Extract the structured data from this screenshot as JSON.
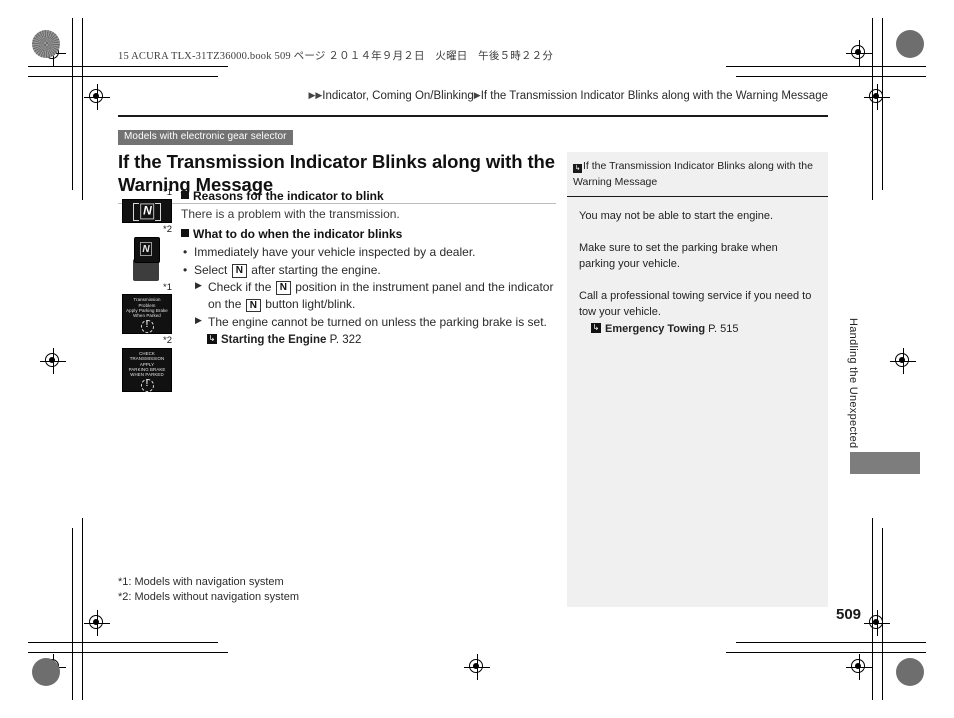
{
  "print_header": "15 ACURA TLX-31TZ36000.book    509 ページ    ２０１４年９月２日　火曜日　午後５時２２分",
  "breadcrumb": {
    "arrow": "▶",
    "section": "Indicator, Coming On/Blinking",
    "topic": "If the Transmission Indicator Blinks along with the Warning Message"
  },
  "left": {
    "model_badge": "Models with electronic gear selector",
    "title": "If the Transmission Indicator Blinks along with the Warning Message",
    "sections": [
      {
        "heading": "Reasons for the indicator to blink",
        "text": "There is a problem with the transmission."
      },
      {
        "heading": "What to do when the indicator blinks"
      }
    ],
    "bullet_1": "Immediately have your vehicle inspected by a dealer.",
    "bullet_2_pre": "Select",
    "bullet_2_key": "N",
    "bullet_2_post": "after starting the engine.",
    "sub_1_a": "Check if the",
    "sub_1_key1": "N",
    "sub_1_b": "position in the instrument panel and the indicator",
    "sub_1_c": "on the",
    "sub_1_key2": "N",
    "sub_1_d": "button light/blink.",
    "sub_2": "The engine cannot be turned on unless the parking brake is set.",
    "xref": {
      "icon": "↳",
      "label": "Starting the Engine",
      "page": "P. 322"
    }
  },
  "figures": [
    {
      "note": "*1",
      "type": "gear-indicator-display",
      "glyph": "N"
    },
    {
      "note": "*2",
      "type": "n-push-button",
      "glyph": "N"
    },
    {
      "note": "*1",
      "type": "multi-info-display-message",
      "lines": [
        "Transmission",
        "Problem",
        "Apply Parking Brake",
        "When Parked"
      ]
    },
    {
      "note": "*2",
      "type": "multi-info-display-message",
      "lines": [
        "CHECK",
        "TRANSMISSION",
        "APPLY",
        "PARKING BRAKE",
        "WHEN PARKED"
      ]
    }
  ],
  "footnotes": [
    "*1: Models with navigation system",
    "*2: Models without navigation system"
  ],
  "side_panel": {
    "mark": "↳",
    "heading": "If the Transmission Indicator Blinks along with the Warning Message",
    "paragraphs": [
      "You may not be able to start the engine.",
      "Make sure to set the parking brake when parking your vehicle.",
      "Call a professional towing service if you need to tow your vehicle."
    ],
    "xref": {
      "icon": "↳",
      "label": "Emergency Towing",
      "page": "P. 515"
    }
  },
  "chapter_tab": "Handling the Unexpected",
  "page_number": "509"
}
